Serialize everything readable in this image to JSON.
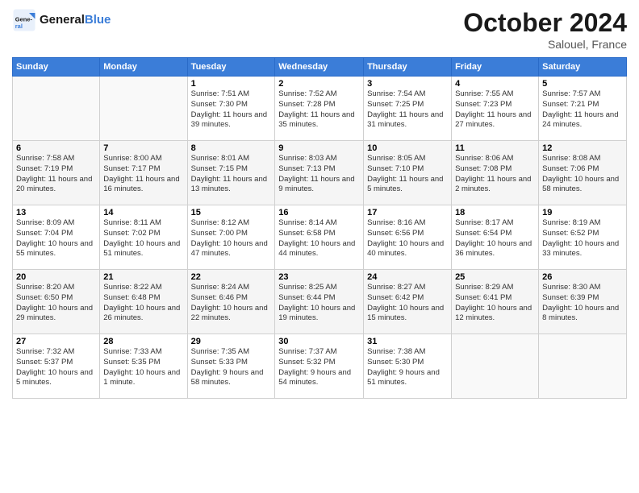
{
  "header": {
    "logo_general": "General",
    "logo_blue": "Blue",
    "month": "October 2024",
    "location": "Salouel, France"
  },
  "days_of_week": [
    "Sunday",
    "Monday",
    "Tuesday",
    "Wednesday",
    "Thursday",
    "Friday",
    "Saturday"
  ],
  "weeks": [
    [
      {
        "day": "",
        "info": ""
      },
      {
        "day": "",
        "info": ""
      },
      {
        "day": "1",
        "info": "Sunrise: 7:51 AM\nSunset: 7:30 PM\nDaylight: 11 hours and 39 minutes."
      },
      {
        "day": "2",
        "info": "Sunrise: 7:52 AM\nSunset: 7:28 PM\nDaylight: 11 hours and 35 minutes."
      },
      {
        "day": "3",
        "info": "Sunrise: 7:54 AM\nSunset: 7:25 PM\nDaylight: 11 hours and 31 minutes."
      },
      {
        "day": "4",
        "info": "Sunrise: 7:55 AM\nSunset: 7:23 PM\nDaylight: 11 hours and 27 minutes."
      },
      {
        "day": "5",
        "info": "Sunrise: 7:57 AM\nSunset: 7:21 PM\nDaylight: 11 hours and 24 minutes."
      }
    ],
    [
      {
        "day": "6",
        "info": "Sunrise: 7:58 AM\nSunset: 7:19 PM\nDaylight: 11 hours and 20 minutes."
      },
      {
        "day": "7",
        "info": "Sunrise: 8:00 AM\nSunset: 7:17 PM\nDaylight: 11 hours and 16 minutes."
      },
      {
        "day": "8",
        "info": "Sunrise: 8:01 AM\nSunset: 7:15 PM\nDaylight: 11 hours and 13 minutes."
      },
      {
        "day": "9",
        "info": "Sunrise: 8:03 AM\nSunset: 7:13 PM\nDaylight: 11 hours and 9 minutes."
      },
      {
        "day": "10",
        "info": "Sunrise: 8:05 AM\nSunset: 7:10 PM\nDaylight: 11 hours and 5 minutes."
      },
      {
        "day": "11",
        "info": "Sunrise: 8:06 AM\nSunset: 7:08 PM\nDaylight: 11 hours and 2 minutes."
      },
      {
        "day": "12",
        "info": "Sunrise: 8:08 AM\nSunset: 7:06 PM\nDaylight: 10 hours and 58 minutes."
      }
    ],
    [
      {
        "day": "13",
        "info": "Sunrise: 8:09 AM\nSunset: 7:04 PM\nDaylight: 10 hours and 55 minutes."
      },
      {
        "day": "14",
        "info": "Sunrise: 8:11 AM\nSunset: 7:02 PM\nDaylight: 10 hours and 51 minutes."
      },
      {
        "day": "15",
        "info": "Sunrise: 8:12 AM\nSunset: 7:00 PM\nDaylight: 10 hours and 47 minutes."
      },
      {
        "day": "16",
        "info": "Sunrise: 8:14 AM\nSunset: 6:58 PM\nDaylight: 10 hours and 44 minutes."
      },
      {
        "day": "17",
        "info": "Sunrise: 8:16 AM\nSunset: 6:56 PM\nDaylight: 10 hours and 40 minutes."
      },
      {
        "day": "18",
        "info": "Sunrise: 8:17 AM\nSunset: 6:54 PM\nDaylight: 10 hours and 36 minutes."
      },
      {
        "day": "19",
        "info": "Sunrise: 8:19 AM\nSunset: 6:52 PM\nDaylight: 10 hours and 33 minutes."
      }
    ],
    [
      {
        "day": "20",
        "info": "Sunrise: 8:20 AM\nSunset: 6:50 PM\nDaylight: 10 hours and 29 minutes."
      },
      {
        "day": "21",
        "info": "Sunrise: 8:22 AM\nSunset: 6:48 PM\nDaylight: 10 hours and 26 minutes."
      },
      {
        "day": "22",
        "info": "Sunrise: 8:24 AM\nSunset: 6:46 PM\nDaylight: 10 hours and 22 minutes."
      },
      {
        "day": "23",
        "info": "Sunrise: 8:25 AM\nSunset: 6:44 PM\nDaylight: 10 hours and 19 minutes."
      },
      {
        "day": "24",
        "info": "Sunrise: 8:27 AM\nSunset: 6:42 PM\nDaylight: 10 hours and 15 minutes."
      },
      {
        "day": "25",
        "info": "Sunrise: 8:29 AM\nSunset: 6:41 PM\nDaylight: 10 hours and 12 minutes."
      },
      {
        "day": "26",
        "info": "Sunrise: 8:30 AM\nSunset: 6:39 PM\nDaylight: 10 hours and 8 minutes."
      }
    ],
    [
      {
        "day": "27",
        "info": "Sunrise: 7:32 AM\nSunset: 5:37 PM\nDaylight: 10 hours and 5 minutes."
      },
      {
        "day": "28",
        "info": "Sunrise: 7:33 AM\nSunset: 5:35 PM\nDaylight: 10 hours and 1 minute."
      },
      {
        "day": "29",
        "info": "Sunrise: 7:35 AM\nSunset: 5:33 PM\nDaylight: 9 hours and 58 minutes."
      },
      {
        "day": "30",
        "info": "Sunrise: 7:37 AM\nSunset: 5:32 PM\nDaylight: 9 hours and 54 minutes."
      },
      {
        "day": "31",
        "info": "Sunrise: 7:38 AM\nSunset: 5:30 PM\nDaylight: 9 hours and 51 minutes."
      },
      {
        "day": "",
        "info": ""
      },
      {
        "day": "",
        "info": ""
      }
    ]
  ]
}
